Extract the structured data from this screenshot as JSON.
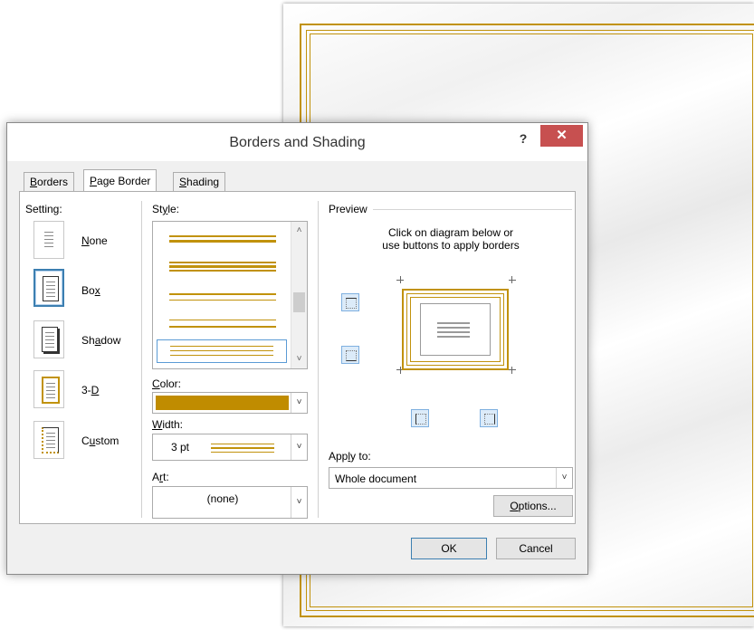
{
  "dialog": {
    "title": "Borders and Shading",
    "help": "?",
    "close": "✕",
    "tabs": [
      {
        "pre": "",
        "key": "B",
        "post": "orders"
      },
      {
        "pre": "",
        "key": "P",
        "post": "age Border"
      },
      {
        "pre": "",
        "key": "S",
        "post": "hading"
      }
    ],
    "ok_label": "OK",
    "cancel_label": "Cancel"
  },
  "setting": {
    "label": "Setting:",
    "items": [
      {
        "pre": "",
        "key": "N",
        "post": "one"
      },
      {
        "pre": "Bo",
        "key": "x",
        "post": ""
      },
      {
        "pre": "Sh",
        "key": "a",
        "post": "dow"
      },
      {
        "pre": "3-",
        "key": "D",
        "post": ""
      },
      {
        "pre": "C",
        "key": "u",
        "post": "stom"
      }
    ]
  },
  "style": {
    "label_pre": "St",
    "label_key": "y",
    "label_post": "le:"
  },
  "color": {
    "label_pre": "",
    "label_key": "C",
    "label_post": "olor:",
    "value": "#c08c00"
  },
  "width": {
    "label_pre": "",
    "label_key": "W",
    "label_post": "idth:",
    "value": "3 pt"
  },
  "art": {
    "label_pre": "A",
    "label_key": "r",
    "label_post": "t:",
    "value": "(none)"
  },
  "preview": {
    "title": "Preview",
    "hint_line1": "Click on diagram below or",
    "hint_line2": "use buttons to apply borders"
  },
  "apply_to": {
    "label_pre": "App",
    "label_key": "l",
    "label_post": "y to:",
    "value": "Whole document"
  },
  "options": {
    "label_pre": "",
    "label_key": "O",
    "label_post": "ptions..."
  },
  "colors": {
    "gold": "#c1920c",
    "title_bg": "#ffffff",
    "close_bg": "#c75050",
    "dialog_bg": "#f0f0f0",
    "selection": "#3c7fb1"
  }
}
